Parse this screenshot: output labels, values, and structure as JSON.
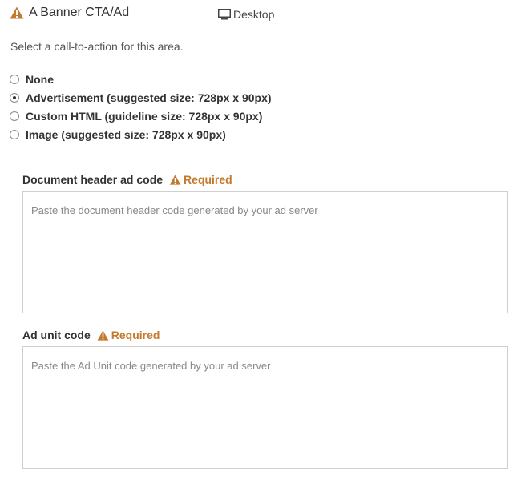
{
  "header": {
    "title": "A Banner CTA/Ad",
    "device_label": "Desktop",
    "warning_icon": "warning-triangle-icon",
    "device_icon": "desktop-monitor-icon"
  },
  "instruction": "Select a call-to-action for this area.",
  "options": [
    {
      "label": "None",
      "selected": false
    },
    {
      "label": "Advertisement (suggested size: 728px x 90px)",
      "selected": true
    },
    {
      "label": "Custom HTML (guideline size: 728px x 90px)",
      "selected": false
    },
    {
      "label": "Image (suggested size: 728px x 90px)",
      "selected": false
    }
  ],
  "fields": {
    "header_code": {
      "label": "Document header ad code",
      "required_text": "Required",
      "placeholder": "Paste the document header code generated by your ad server",
      "value": ""
    },
    "ad_unit_code": {
      "label": "Ad unit code",
      "required_text": "Required",
      "placeholder": "Paste the Ad Unit code generated by your ad server",
      "value": ""
    }
  },
  "colors": {
    "warning": "#c47a2c",
    "text": "#333333",
    "border": "#cfcfcf"
  }
}
